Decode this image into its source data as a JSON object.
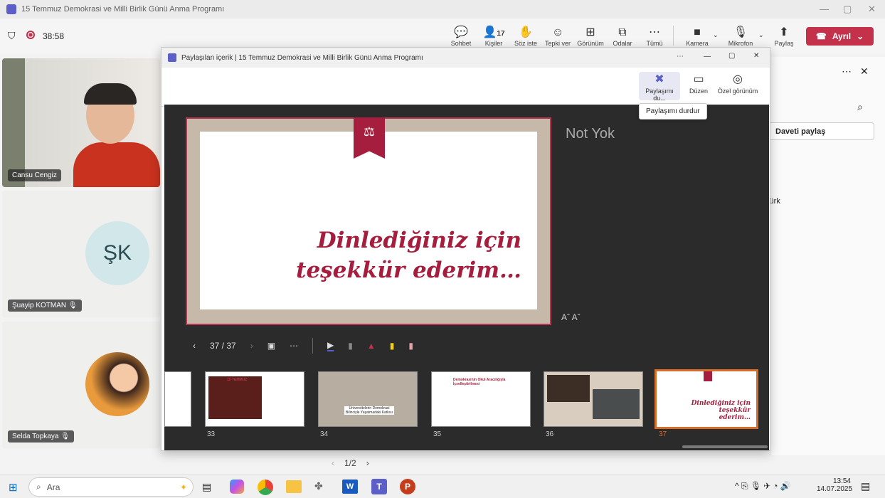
{
  "window_title": "15 Temmuz Demokrasi ve Milli Birlik Günü Anma Programı",
  "meeting": {
    "timer": "38:58",
    "toolbar": [
      {
        "label": "Sohbet",
        "icon": "chat-icon"
      },
      {
        "label": "Kişiler",
        "icon": "people-icon",
        "count": "17"
      },
      {
        "label": "Söz iste",
        "icon": "raise-hand-icon"
      },
      {
        "label": "Tepki ver",
        "icon": "react-icon"
      },
      {
        "label": "Görünüm",
        "icon": "view-icon"
      },
      {
        "label": "Odalar",
        "icon": "rooms-icon"
      },
      {
        "label": "Tümü",
        "icon": "more-icon"
      },
      {
        "label": "Kamera",
        "icon": "camera-icon"
      },
      {
        "label": "Mikrofon",
        "icon": "mic-icon"
      },
      {
        "label": "Paylaş",
        "icon": "share-icon"
      }
    ],
    "leave_label": "Ayrıl"
  },
  "participants": [
    {
      "name": "Cansu Cengiz"
    },
    {
      "name": "Şuayip KOTMAN",
      "initials": "ŞK"
    },
    {
      "name": "Selda Topkaya"
    }
  ],
  "share_window": {
    "title": "Paylaşılan içerik | 15 Temmuz Demokrasi ve Milli Birlik Günü Anma Programı",
    "controls": [
      {
        "label": "Paylaşımı du...",
        "icon": "stop-share-icon"
      },
      {
        "label": "Düzen",
        "icon": "layout-icon"
      },
      {
        "label": "Özel görünüm",
        "icon": "private-view-icon"
      }
    ],
    "tooltip": "Paylaşımı durdur",
    "slide_text_line1": "Dinlediğiniz için",
    "slide_text_line2": "teşekkür ederim…",
    "notes": "Not Yok",
    "slide_counter": "37 / 37",
    "thumb_numbers": [
      "33",
      "34",
      "35",
      "36",
      "37"
    ],
    "thumb35_title": "Demokrasinin Okul Aracılığıyla İçselleştirilmesi",
    "thumb34_caption": "Üniversitelerin Demokrasi Bilinciyle Yaşatmadaki Katkısı",
    "thumb33_title": "15 TEMMUZ",
    "thumb37_text": "Dinlediğiniz için teşekkür ederim…"
  },
  "right_pane": {
    "invite_label": "Daveti paylaş",
    "partial_text": "ztürk"
  },
  "pager": "1/2",
  "taskbar": {
    "search_placeholder": "Ara",
    "time": "13:54",
    "date": "14.07.2025"
  }
}
